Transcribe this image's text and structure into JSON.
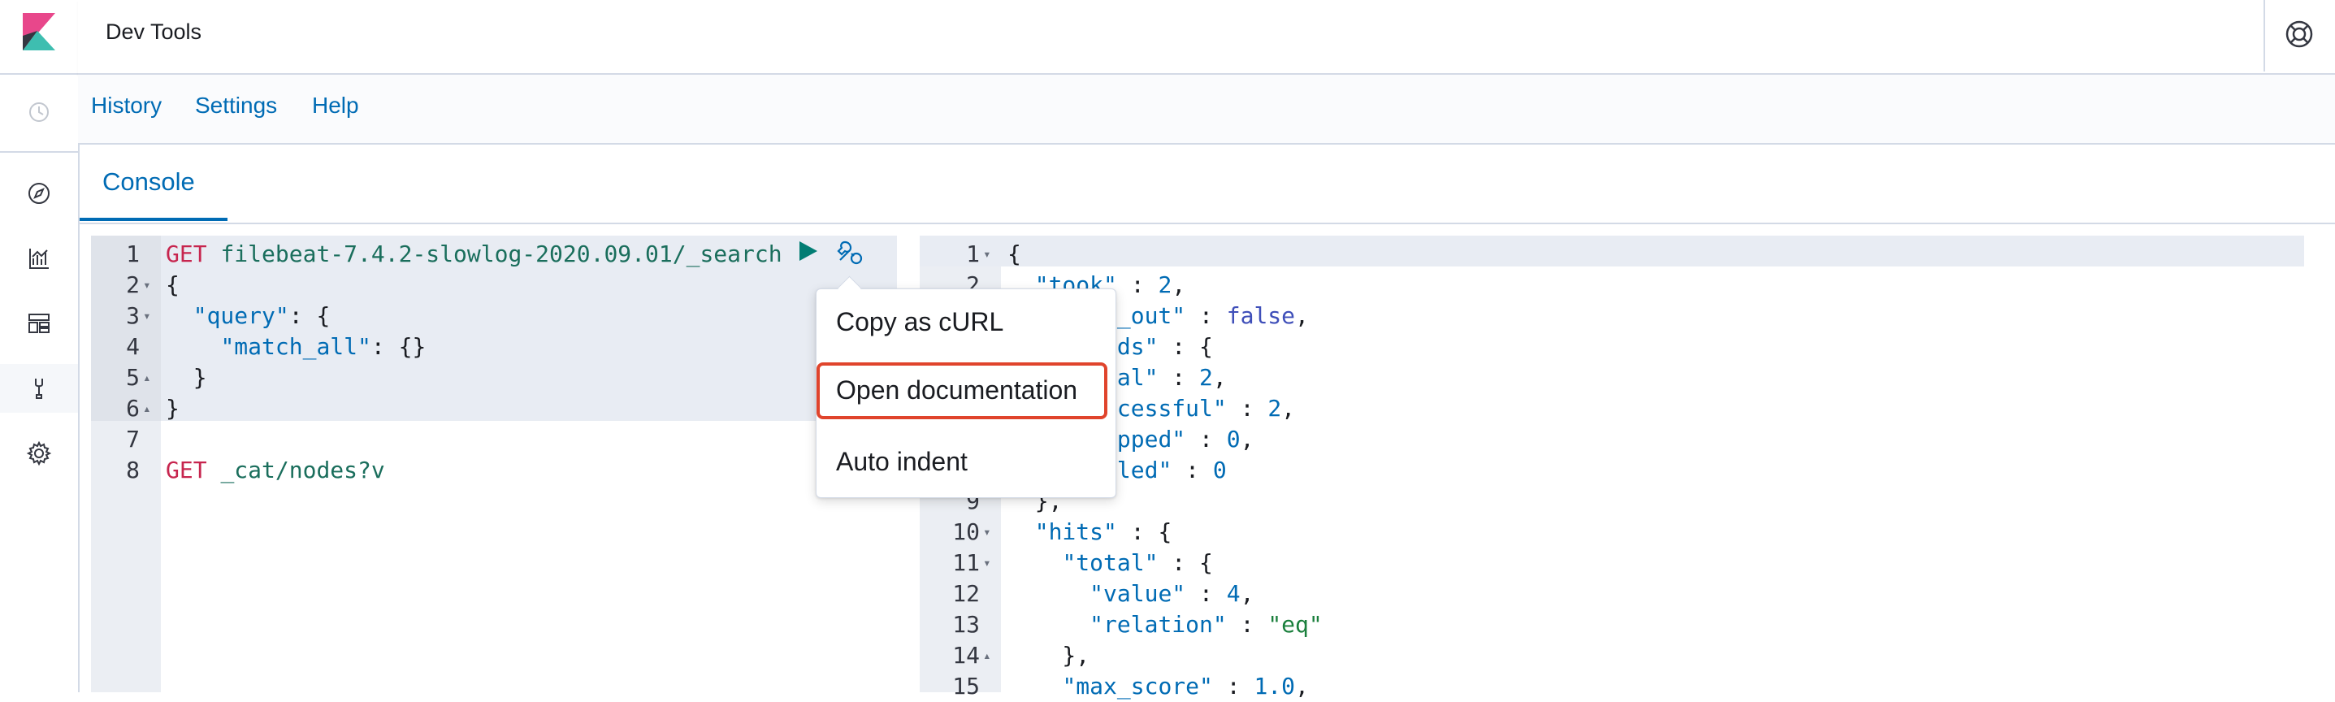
{
  "header": {
    "title": "Dev Tools"
  },
  "topmenu": {
    "history": "History",
    "settings": "Settings",
    "help": "Help"
  },
  "tabs": {
    "console": "Console"
  },
  "request_editor": {
    "lines": [
      {
        "n": "1",
        "fold": "",
        "parts": [
          [
            "k-method",
            "GET"
          ],
          [
            "k-plain",
            " "
          ],
          [
            "k-url",
            "filebeat-7.4.2-slowlog-2020.09.01/_search"
          ]
        ]
      },
      {
        "n": "2",
        "fold": "▾",
        "parts": [
          [
            "k-plain",
            "{"
          ]
        ]
      },
      {
        "n": "3",
        "fold": "▾",
        "parts": [
          [
            "k-plain",
            "  "
          ],
          [
            "k-key",
            "\"query\""
          ],
          [
            "k-plain",
            ": {"
          ]
        ]
      },
      {
        "n": "4",
        "fold": "",
        "parts": [
          [
            "k-plain",
            "    "
          ],
          [
            "k-key",
            "\"match_all\""
          ],
          [
            "k-plain",
            ": {}"
          ]
        ]
      },
      {
        "n": "5",
        "fold": "▴",
        "parts": [
          [
            "k-plain",
            "  }"
          ]
        ]
      },
      {
        "n": "6",
        "fold": "▴",
        "parts": [
          [
            "k-plain",
            "}"
          ]
        ]
      },
      {
        "n": "7",
        "fold": "",
        "parts": []
      },
      {
        "n": "8",
        "fold": "",
        "parts": [
          [
            "k-method",
            "GET"
          ],
          [
            "k-plain",
            " "
          ],
          [
            "k-url",
            "_cat/nodes?v"
          ]
        ]
      }
    ]
  },
  "response_editor": {
    "lines": [
      {
        "n": "1",
        "fold": "▾",
        "parts": [
          [
            "k-plain",
            "{"
          ]
        ]
      },
      {
        "n": "2",
        "fold": "",
        "parts": [
          [
            "k-plain",
            "  "
          ],
          [
            "k-key",
            "\"took\""
          ],
          [
            "k-plain",
            " : "
          ],
          [
            "k-num",
            "2"
          ],
          [
            "k-plain",
            ","
          ]
        ]
      },
      {
        "n": "3",
        "fold": "",
        "parts": [
          [
            "k-plain",
            "  "
          ],
          [
            "k-key",
            "\"timed_out\""
          ],
          [
            "k-plain",
            " : "
          ],
          [
            "k-bool",
            "false"
          ],
          [
            "k-plain",
            ","
          ]
        ]
      },
      {
        "n": "4",
        "fold": "",
        "parts": [
          [
            "k-plain",
            "  "
          ],
          [
            "k-key",
            "\"_shards\""
          ],
          [
            "k-plain",
            " : {"
          ]
        ]
      },
      {
        "n": "5",
        "fold": "",
        "parts": [
          [
            "k-plain",
            "    "
          ],
          [
            "k-key",
            "\"total\""
          ],
          [
            "k-plain",
            " : "
          ],
          [
            "k-num",
            "2"
          ],
          [
            "k-plain",
            ","
          ]
        ]
      },
      {
        "n": "6",
        "fold": "",
        "parts": [
          [
            "k-plain",
            "    "
          ],
          [
            "k-key",
            "\"successful\""
          ],
          [
            "k-plain",
            " : "
          ],
          [
            "k-num",
            "2"
          ],
          [
            "k-plain",
            ","
          ]
        ]
      },
      {
        "n": "7",
        "fold": "",
        "parts": [
          [
            "k-plain",
            "    "
          ],
          [
            "k-key",
            "\"skipped\""
          ],
          [
            "k-plain",
            " : "
          ],
          [
            "k-num",
            "0"
          ],
          [
            "k-plain",
            ","
          ]
        ]
      },
      {
        "n": "8",
        "fold": "",
        "parts": [
          [
            "k-plain",
            "    "
          ],
          [
            "k-key",
            "\"failed\""
          ],
          [
            "k-plain",
            " : "
          ],
          [
            "k-num",
            "0"
          ]
        ]
      },
      {
        "n": "9",
        "fold": "",
        "parts": [
          [
            "k-plain",
            "  },"
          ]
        ]
      },
      {
        "n": "10",
        "fold": "▾",
        "parts": [
          [
            "k-plain",
            "  "
          ],
          [
            "k-key",
            "\"hits\""
          ],
          [
            "k-plain",
            " : {"
          ]
        ]
      },
      {
        "n": "11",
        "fold": "▾",
        "parts": [
          [
            "k-plain",
            "    "
          ],
          [
            "k-key",
            "\"total\""
          ],
          [
            "k-plain",
            " : {"
          ]
        ]
      },
      {
        "n": "12",
        "fold": "",
        "parts": [
          [
            "k-plain",
            "      "
          ],
          [
            "k-key",
            "\"value\""
          ],
          [
            "k-plain",
            " : "
          ],
          [
            "k-num",
            "4"
          ],
          [
            "k-plain",
            ","
          ]
        ]
      },
      {
        "n": "13",
        "fold": "",
        "parts": [
          [
            "k-plain",
            "      "
          ],
          [
            "k-key",
            "\"relation\""
          ],
          [
            "k-plain",
            " : "
          ],
          [
            "k-str",
            "\"eq\""
          ]
        ]
      },
      {
        "n": "14",
        "fold": "▴",
        "parts": [
          [
            "k-plain",
            "    },"
          ]
        ]
      },
      {
        "n": "15",
        "fold": "",
        "parts": [
          [
            "k-plain",
            "    "
          ],
          [
            "k-key",
            "\"max_score\""
          ],
          [
            "k-plain",
            " : "
          ],
          [
            "k-num",
            "1.0"
          ],
          [
            "k-plain",
            ","
          ]
        ]
      }
    ]
  },
  "context_menu": {
    "items": [
      "Copy as cURL",
      "Open documentation",
      "Auto indent"
    ]
  },
  "icons": {
    "logo": "kibana-logo",
    "recent": "clock-icon",
    "discover": "compass-icon",
    "visualize": "chart-icon",
    "dashboard": "dashboard-icon",
    "devtools": "wrench-icon",
    "management": "gear-icon",
    "help": "lifebuoy-icon",
    "run": "play-icon",
    "actions": "wrench-icon"
  },
  "colors": {
    "accent": "#006bb4",
    "highlight_border": "#e0442c",
    "play": "#017d73"
  }
}
